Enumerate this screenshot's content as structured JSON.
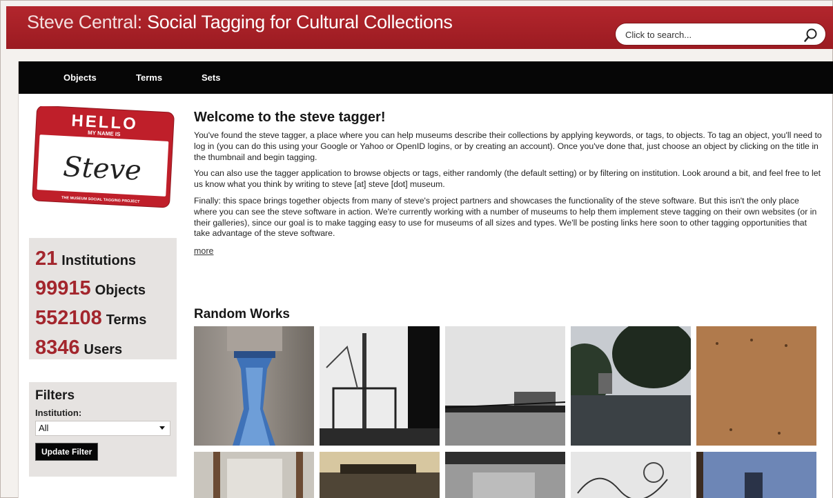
{
  "header": {
    "title_prefix": "Steve Central:",
    "title_main": " Social Tagging for Cultural Collections",
    "search_placeholder": "Click to search..."
  },
  "nav": {
    "items": [
      {
        "label": "Objects"
      },
      {
        "label": "Terms"
      },
      {
        "label": "Sets"
      }
    ]
  },
  "badge": {
    "hello": "HELLO",
    "my_name_is": "MY NAME IS",
    "name": "Steve",
    "project": "THE MUSEUM SOCIAL TAGGING PROJECT"
  },
  "stats": [
    {
      "value": "21",
      "label": "Institutions"
    },
    {
      "value": "99915",
      "label": "Objects"
    },
    {
      "value": "552108",
      "label": "Terms"
    },
    {
      "value": "8346",
      "label": "Users"
    }
  ],
  "filters": {
    "title": "Filters",
    "institution_label": "Institution:",
    "institution_value": "All",
    "update_button": "Update Filter"
  },
  "welcome": {
    "title": "Welcome to the steve tagger!",
    "p1": "You've found the steve tagger, a place where you can help museums describe their collections by applying keywords, or tags, to objects. To tag an object, you'll need to log in (you can do this using your Google or Yahoo or OpenID logins, or by creating an account). Once you've done that, just choose an object by clicking on the title in the thumbnail and begin tagging.",
    "p2": "You can also use the tagger application to browse objects or tags, either randomly (the default setting) or by filtering on institution. Look around a bit, and feel free to let us know what you think by writing to steve [at] steve [dot] museum.",
    "p3": "Finally: this space brings together objects from many of steve's project partners and showcases the functionality of the steve software. But this isn't the only place where you can see the steve software in action. We're currently working with a number of museums to help them implement steve tagging on their own websites (or in their galleries), since our goal is to make tagging easy to use for museums of all sizes and types. We'll be posting links here soon to other tagging opportunities that take advantage of the steve software.",
    "more": "more"
  },
  "random_works": {
    "title": "Random Works"
  },
  "colors": {
    "brand_red": "#a3262d",
    "nav_black": "#060606"
  }
}
